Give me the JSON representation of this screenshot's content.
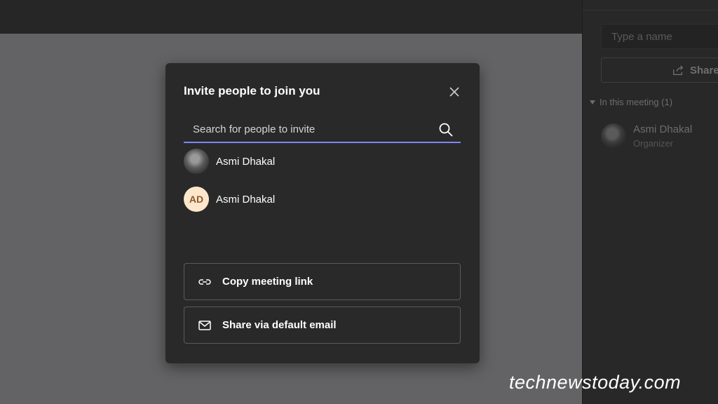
{
  "side_panel": {
    "name_input_placeholder": "Type a name",
    "share_label": "Share",
    "section_header": "In this meeting (1)",
    "participant": {
      "name": "Asmi Dhakal",
      "role": "Organizer"
    }
  },
  "dialog": {
    "title": "Invite people to join you",
    "search_placeholder": "Search for people to invite",
    "people": [
      {
        "name": "Asmi Dhakal",
        "avatar": "photo"
      },
      {
        "name": "Asmi Dhakal",
        "avatar": "initials",
        "initials": "AD"
      }
    ],
    "copy_link_label": "Copy meeting link",
    "share_email_label": "Share via default email"
  },
  "watermark": "technewstoday.com",
  "colors": {
    "accent": "#7f85f5",
    "dialog_bg": "#292929",
    "initials_bg": "#fde7cc",
    "initials_fg": "#8a5a2b"
  },
  "icons": [
    "close-icon",
    "search-icon",
    "link-icon",
    "mail-icon",
    "share-icon"
  ]
}
